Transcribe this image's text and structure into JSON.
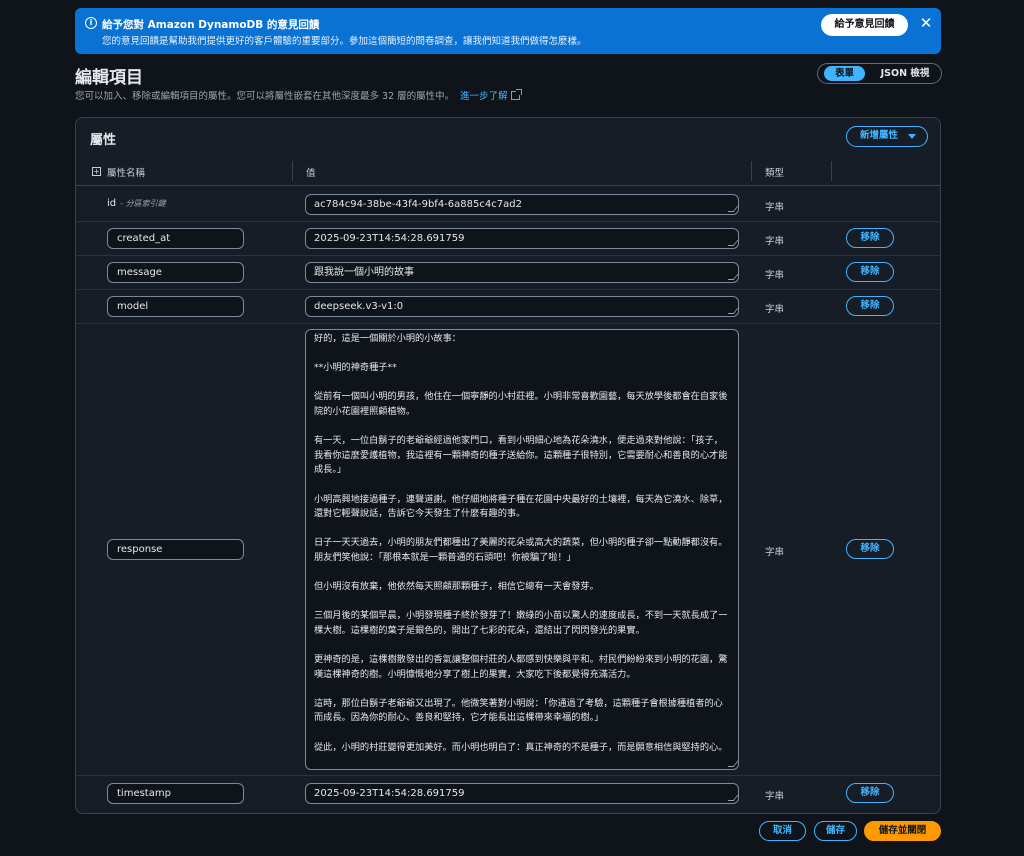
{
  "banner": {
    "title": "給予您對 Amazon DynamoDB 的意見回饋",
    "description": "您的意見回饋是幫助我們提供更好的客戶體驗的重要部分。參加這個簡短的問卷調查，讓我們知道我們做得怎麼樣。",
    "feedback_button": "給予意見回饋",
    "close_glyph": "✕",
    "info_glyph": "i",
    "accent_color": "#0972d3"
  },
  "header": {
    "title": "編輯項目",
    "description": "您可以加入、移除或編輯項目的屬性。您可以將屬性嵌套在其他深度最多 32 層的屬性中。",
    "learn_more": "進一步了解",
    "view_toggle": {
      "form": "表單",
      "json": "JSON 檢視",
      "selected": "表單"
    }
  },
  "attributes": {
    "title": "屬性",
    "add_button": "新增屬性",
    "columns": {
      "name": "屬性名稱",
      "value": "值",
      "type": "類型"
    },
    "rows": [
      {
        "name": "id",
        "sub": "- 分區索引鍵",
        "value": "ac784c94-38be-43f4-9bf4-6a885c4c7ad2",
        "type": "字串"
      },
      {
        "name": "created_at",
        "value": "2025-09-23T14:54:28.691759",
        "type": "字串",
        "remove": "移除"
      },
      {
        "name": "message",
        "value": "跟我說一個小明的故事",
        "type": "字串",
        "remove": "移除"
      },
      {
        "name": "model",
        "value": "deepseek.v3-v1:0",
        "type": "字串",
        "remove": "移除"
      },
      {
        "name": "response",
        "value": "好的，這是一個關於小明的小故事：\n\n**小明的神奇種子**\n\n從前有一個叫小明的男孩，他住在一個寧靜的小村莊裡。小明非常喜歡園藝，每天放學後都會在自家後院的小花園裡照顧植物。\n\n有一天，一位白鬍子的老爺爺經過他家門口，看到小明細心地為花朵澆水，便走過來對他說：「孩子，我看你這麼愛護植物，我這裡有一顆神奇的種子送給你。這顆種子很特別，它需要耐心和善良的心才能成長。」\n\n小明高興地接過種子，連聲道謝。他仔細地將種子種在花園中央最好的土壤裡，每天為它澆水、除草，還對它輕聲說話，告訴它今天發生了什麼有趣的事。\n\n日子一天天過去，小明的朋友們都種出了美麗的花朵或高大的蔬菜，但小明的種子卻一點動靜都沒有。朋友們笑他說：「那根本就是一顆普通的石頭吧！你被騙了啦！」\n\n但小明沒有放棄，他依然每天照顧那顆種子，相信它總有一天會發芽。\n\n三個月後的某個早晨，小明發現種子終於發芽了！嫩綠的小苗以驚人的速度成長，不到一天就長成了一棵大樹。這棵樹的葉子是銀色的，開出了七彩的花朵，還結出了閃閃發光的果實。\n\n更神奇的是，這棵樹散發出的香氣讓整個村莊的人都感到快樂與平和。村民們紛紛來到小明的花園，驚嘆這棵神奇的樹。小明慷慨地分享了樹上的果實，大家吃下後都覺得充滿活力。\n\n這時，那位白鬍子老爺爺又出現了。他微笑著對小明說：「你通過了考驗，這顆種子會根據種植者的心而成長。因為你的耐心、善良和堅持，它才能長出這棵帶來幸福的樹。」\n\n從此，小明的村莊變得更加美好。而小明也明白了：真正神奇的不是種子，而是願意相信與堅持的心。\n\n這個故事告訴我們，耐心和善良往往能帶來意想不到的美好結果。",
        "type": "字串",
        "remove": "移除"
      },
      {
        "name": "timestamp",
        "value": "2025-09-23T14:54:28.691759",
        "type": "字串",
        "remove": "移除"
      }
    ]
  },
  "footer": {
    "cancel": "取消",
    "save": "儲存",
    "save_and_close": "儲存並關閉"
  },
  "colors": {
    "accent": "#42b4ff",
    "primary": "#ff9900",
    "background": "#0f141a"
  }
}
